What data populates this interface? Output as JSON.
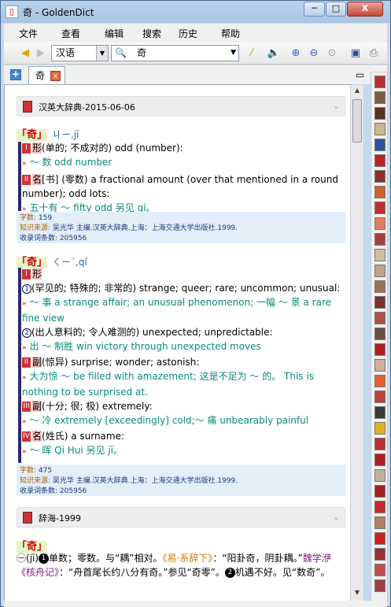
{
  "window": {
    "title": "奇 - GoldenDict",
    "minimize": "─",
    "maximize": "□",
    "close": "X"
  },
  "menu": [
    "文件",
    "查看",
    "编辑",
    "搜索",
    "历史",
    "帮助"
  ],
  "toolbar": {
    "language": "汉语",
    "query": "奇"
  },
  "tabs": {
    "active": "奇",
    "close": "x"
  },
  "articles": [
    {
      "dict_name": "汉英大辞典-2015-06-06",
      "headword": "「奇」",
      "pron": "ㄐㄧ,jī",
      "senses": [
        {
          "num": "I",
          "pos": "形",
          "text": "(单的; 不成对的) odd (number):",
          "examples": [
            "～ 数 odd number"
          ]
        },
        {
          "num": "II",
          "pos": "名",
          "text": "[书] (零数) a fractional amount (over that mentioned in a round number); odd lots:",
          "examples": [
            "五十有 ～ fifty odd 另见 qí。"
          ]
        }
      ],
      "info_count_label": "字数:",
      "info_count": "159",
      "info_source_label": "知识来源:",
      "info_source": "吴光华 主编.汉英大辞典.上海：上海交通大学出版社.1999.",
      "info_total_label": "收录词条数:",
      "info_total": "205956"
    },
    {
      "headword": "「奇」",
      "pron": "ㄑㄧˊ,qí",
      "sense1_num": "I",
      "sense1_pos": "形",
      "sub1_mark": "1",
      "sub1_text": "(罕见的; 特殊的; 非常的) strange; queer; rare; uncommon; unusual:",
      "sub1_ex": "～ 事 a strange affair; an unusual phenomenon; 一幅 ～ 景 a rare fine view",
      "sub2_mark": "2",
      "sub2_text": "(出人意料的; 令人难测的) unexpected; unpredictable:",
      "sub2_ex": "出 ～ 制胜 win victory through unexpected moves",
      "sense2_num": "II",
      "sense2_pos": "副",
      "sense2_text": "(惊异) surprise; wonder; astonish:",
      "sense2_ex": "大为惊 ～ be filled with amazement; 这是不足为 ～ 的。 This is nothing to be surprised at.",
      "sense3_num": "III",
      "sense3_pos": "副",
      "sense3_text": "(十分; 很; 极) extremely:",
      "sense3_ex": "～ 冷 extremely [exceedingly] cold;～ 痛 unbearably painful",
      "sense4_num": "IV",
      "sense4_pos": "名",
      "sense4_text": "(姓氏) a surname:",
      "sense4_ex": "～ 晖 Qi Hui 另见 jī。",
      "info_count_label": "字数:",
      "info_count": "475",
      "info_source_label": "知识来源:",
      "info_source": "吴光华 主编.汉英大辞典.上海：上海交通大学出版社.1999.",
      "info_total_label": "收录词条数:",
      "info_total": "205956"
    },
    {
      "dict_name": "辞海-1999",
      "headword": "「奇」",
      "mark": "㊀",
      "pron": "(jī)",
      "def_a": "单数；零数。与“耦”相对。",
      "ref1": "《易·系辞下》",
      "def_b": "：“阳卦奇，阴卦耦。”",
      "ref2": "魏学洢《核舟记》",
      "def_c": "：“舟首尾长约八分有奇。”参见“奇零”。",
      "def_d": "机遇不好。见“数奇”。",
      "m1": "1",
      "m2": "2"
    }
  ]
}
